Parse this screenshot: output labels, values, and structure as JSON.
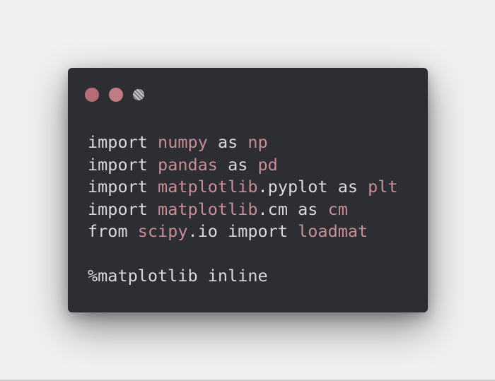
{
  "window": {
    "buttons": [
      {
        "color": "#b46d74"
      },
      {
        "color": "#c17b82"
      },
      {
        "color": "#9a9a9a"
      }
    ]
  },
  "code": {
    "lines": [
      [
        {
          "t": "import",
          "c": "kw"
        },
        {
          "t": " ",
          "c": "plain"
        },
        {
          "t": "numpy",
          "c": "name"
        },
        {
          "t": " as ",
          "c": "kw"
        },
        {
          "t": "np",
          "c": "name"
        }
      ],
      [
        {
          "t": "import",
          "c": "kw"
        },
        {
          "t": " ",
          "c": "plain"
        },
        {
          "t": "pandas",
          "c": "name"
        },
        {
          "t": " as ",
          "c": "kw"
        },
        {
          "t": "pd",
          "c": "name"
        }
      ],
      [
        {
          "t": "import",
          "c": "kw"
        },
        {
          "t": " ",
          "c": "plain"
        },
        {
          "t": "matplotlib",
          "c": "name"
        },
        {
          "t": ".pyplot as ",
          "c": "plain"
        },
        {
          "t": "plt",
          "c": "name"
        }
      ],
      [
        {
          "t": "import",
          "c": "kw"
        },
        {
          "t": " ",
          "c": "plain"
        },
        {
          "t": "matplotlib",
          "c": "name"
        },
        {
          "t": ".cm as ",
          "c": "plain"
        },
        {
          "t": "cm",
          "c": "name"
        }
      ],
      [
        {
          "t": "from",
          "c": "kw"
        },
        {
          "t": " ",
          "c": "plain"
        },
        {
          "t": "scipy",
          "c": "name"
        },
        {
          "t": ".io import ",
          "c": "plain"
        },
        {
          "t": "loadmat",
          "c": "name"
        }
      ],
      [],
      [
        {
          "t": "%matplotlib inline",
          "c": "plain"
        }
      ]
    ]
  },
  "colors": {
    "background": "#f0f0f0",
    "window": "#2c2e34",
    "text": "#d7d9de",
    "name": "#c98d94"
  }
}
